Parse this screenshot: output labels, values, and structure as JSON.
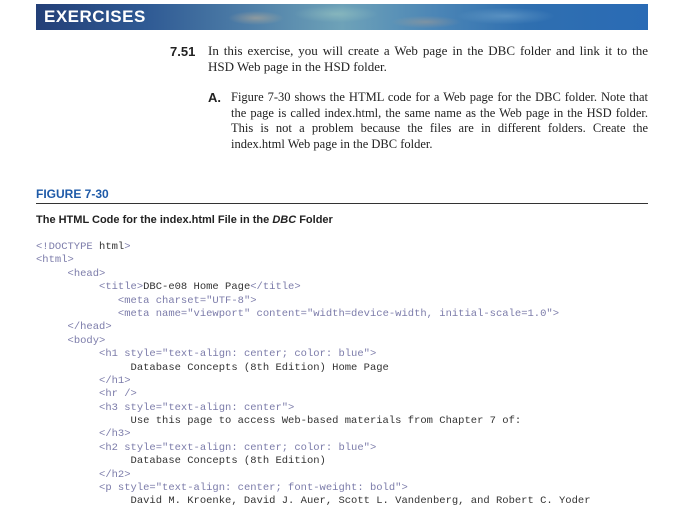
{
  "banner": {
    "title": "EXERCISES"
  },
  "exercise": {
    "number": "7.51",
    "text": "In this exercise, you will create a Web page in the DBC folder and link it to the HSD Web page in the HSD folder.",
    "part_letter": "A.",
    "part_text": "Figure 7-30 shows the HTML code for a Web page for the DBC folder. Note that the page is called index.html, the same name as the Web page in the HSD folder. This is not a problem because the files are in different folders. Create the index.html Web page in the DBC folder."
  },
  "figure": {
    "label": "FIGURE 7-30",
    "caption_prefix": "The HTML Code for the index.html File in the ",
    "caption_italic": "DBC",
    "caption_suffix": " Folder"
  },
  "code_lines": [
    {
      "indent": "",
      "parts": [
        {
          "t": "<!DOCTYPE ",
          "c": "tag"
        },
        {
          "t": "html",
          "c": "txt"
        },
        {
          "t": ">",
          "c": "tag"
        }
      ]
    },
    {
      "indent": "",
      "parts": [
        {
          "t": "<html>",
          "c": "tag"
        }
      ]
    },
    {
      "indent": "     ",
      "parts": [
        {
          "t": "<head>",
          "c": "tag"
        }
      ]
    },
    {
      "indent": "          ",
      "parts": [
        {
          "t": "<title>",
          "c": "tag"
        },
        {
          "t": "DBC-e08 Home Page",
          "c": "txt"
        },
        {
          "t": "</title>",
          "c": "tag"
        }
      ]
    },
    {
      "indent": "             ",
      "parts": [
        {
          "t": "<meta charset=\"UTF-8\">",
          "c": "tag"
        }
      ]
    },
    {
      "indent": "             ",
      "parts": [
        {
          "t": "<meta name=\"viewport\" content=\"width=device-width, initial-scale=1.0\">",
          "c": "tag"
        }
      ]
    },
    {
      "indent": "     ",
      "parts": [
        {
          "t": "</head>",
          "c": "tag"
        }
      ]
    },
    {
      "indent": "     ",
      "parts": [
        {
          "t": "<body>",
          "c": "tag"
        }
      ]
    },
    {
      "indent": "          ",
      "parts": [
        {
          "t": "<h1 style=\"text-align: center; color: blue\">",
          "c": "tag"
        }
      ]
    },
    {
      "indent": "               ",
      "parts": [
        {
          "t": "Database Concepts (8th Edition) Home Page",
          "c": "txt"
        }
      ]
    },
    {
      "indent": "          ",
      "parts": [
        {
          "t": "</h1>",
          "c": "tag"
        }
      ]
    },
    {
      "indent": "          ",
      "parts": [
        {
          "t": "<hr />",
          "c": "tag"
        }
      ]
    },
    {
      "indent": "          ",
      "parts": [
        {
          "t": "<h3 style=\"text-align: center\">",
          "c": "tag"
        }
      ]
    },
    {
      "indent": "               ",
      "parts": [
        {
          "t": "Use this page to access Web-based materials from Chapter 7 of:",
          "c": "txt"
        }
      ]
    },
    {
      "indent": "          ",
      "parts": [
        {
          "t": "</h3>",
          "c": "tag"
        }
      ]
    },
    {
      "indent": "          ",
      "parts": [
        {
          "t": "<h2 style=\"text-align: center; color: blue\">",
          "c": "tag"
        }
      ]
    },
    {
      "indent": "               ",
      "parts": [
        {
          "t": "Database Concepts (8th Edition)",
          "c": "txt"
        }
      ]
    },
    {
      "indent": "          ",
      "parts": [
        {
          "t": "</h2>",
          "c": "tag"
        }
      ]
    },
    {
      "indent": "          ",
      "parts": [
        {
          "t": "<p style=\"text-align: center; font-weight: bold\">",
          "c": "tag"
        }
      ]
    },
    {
      "indent": "               ",
      "parts": [
        {
          "t": "David M. Kroenke, David J. Auer, Scott L. Vandenberg, and Robert C. Yoder",
          "c": "txt"
        }
      ]
    }
  ]
}
